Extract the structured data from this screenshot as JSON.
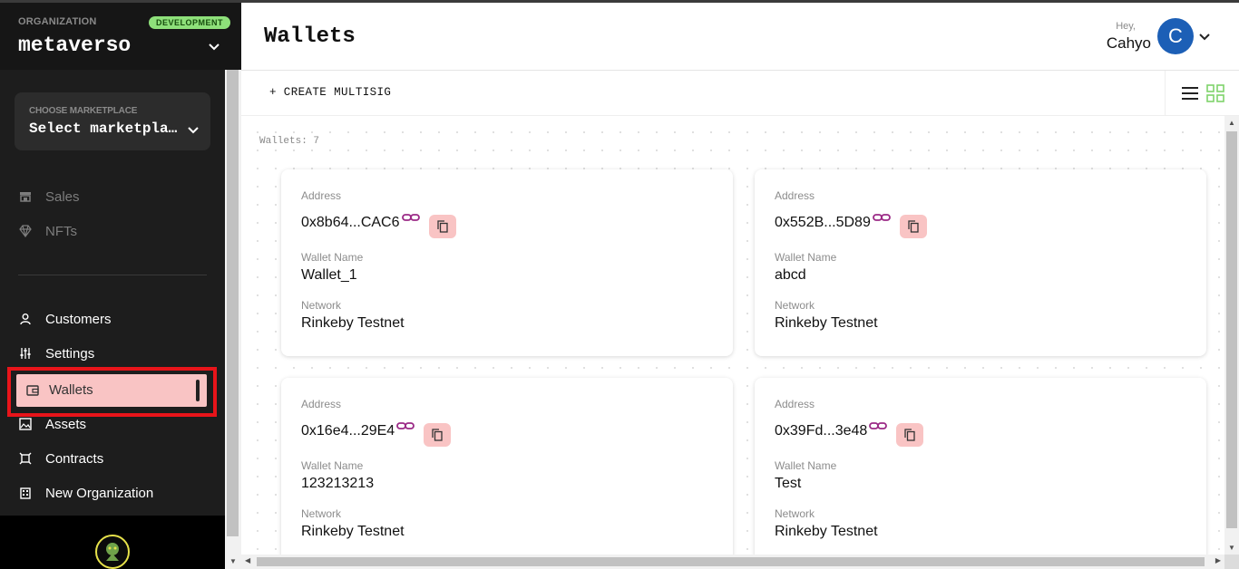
{
  "organization": {
    "label": "ORGANIZATION",
    "badge": "DEVELOPMENT",
    "name": "metaverso"
  },
  "marketplace": {
    "label": "CHOOSE MARKETPLACE",
    "value": "Select marketplace"
  },
  "sidebar": {
    "items": [
      {
        "label": "Sales",
        "icon": "store-icon"
      },
      {
        "label": "NFTs",
        "icon": "diamond-icon"
      },
      {
        "label": "Customers",
        "icon": "person-icon"
      },
      {
        "label": "Settings",
        "icon": "sliders-icon"
      },
      {
        "label": "Wallets",
        "icon": "wallet-icon",
        "active": true
      },
      {
        "label": "Assets",
        "icon": "image-icon"
      },
      {
        "label": "Contracts",
        "icon": "contract-icon"
      },
      {
        "label": "New Organization",
        "icon": "building-icon"
      }
    ]
  },
  "header": {
    "title": "Wallets",
    "greeting": "Hey,",
    "user_name": "Cahyo",
    "avatar_initial": "C"
  },
  "toolbar": {
    "create_label": "+ CREATE MULTISIG"
  },
  "content": {
    "wallet_count": "Wallets: 7",
    "labels": {
      "address": "Address",
      "wallet_name": "Wallet Name",
      "network": "Network"
    },
    "wallets": [
      {
        "address": "0x8b64...CAC6",
        "name": "Wallet_1",
        "network": "Rinkeby Testnet"
      },
      {
        "address": "0x552B...5D89",
        "name": "abcd",
        "network": "Rinkeby Testnet"
      },
      {
        "address": "0x16e4...29E4",
        "name": "123213213",
        "network": "Rinkeby Testnet"
      },
      {
        "address": "0x39Fd...3e48",
        "name": "Test",
        "network": "Rinkeby Testnet"
      }
    ]
  },
  "colors": {
    "active_bg": "#f9c4c4",
    "badge_bg": "#8ee07a",
    "avatar_bg": "#1c5fb6",
    "link_icon": "#9b2a86",
    "grid_icon": "#7fd36b",
    "highlight": "#e8141a"
  }
}
